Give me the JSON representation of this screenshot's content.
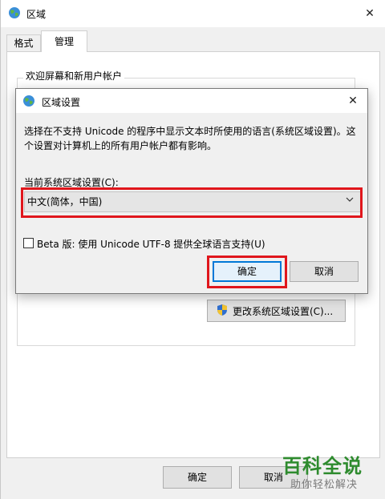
{
  "window": {
    "title": "区域",
    "close_glyph": "✕",
    "icon": "globe-icon"
  },
  "tabs": [
    {
      "label": "格式",
      "active": false
    },
    {
      "label": "管理",
      "active": true
    }
  ],
  "panel": {
    "welcome_label": "欢迎屏幕和新用户帐户",
    "change_locale_button": "更改系统区域设置(C)...",
    "change_locale_icon": "uac-shield-icon"
  },
  "footer": {
    "ok_label": "确定",
    "cancel_label": "取消"
  },
  "dialog": {
    "title": "区域设置",
    "close_glyph": "✕",
    "description": "选择在不支持 Unicode 的程序中显示文本时所使用的语言(系统区域设置)。这个设置对计算机上的所有用户帐户都有影响。",
    "current_label": "当前系统区域设置(C):",
    "selected_locale": "中文(简体，中国)",
    "chevron": "﹀",
    "beta_label": "Beta 版: 使用 Unicode UTF-8 提供全球语言支持(U)",
    "beta_checked": false,
    "ok_label": "确定",
    "cancel_label": "取消"
  },
  "watermark": {
    "main": "百科全说",
    "sub": "助你轻松解决"
  },
  "colors": {
    "highlight_red": "#e0161c",
    "focus_blue": "#0078d7",
    "watermark_green": "#2e8b2e"
  }
}
